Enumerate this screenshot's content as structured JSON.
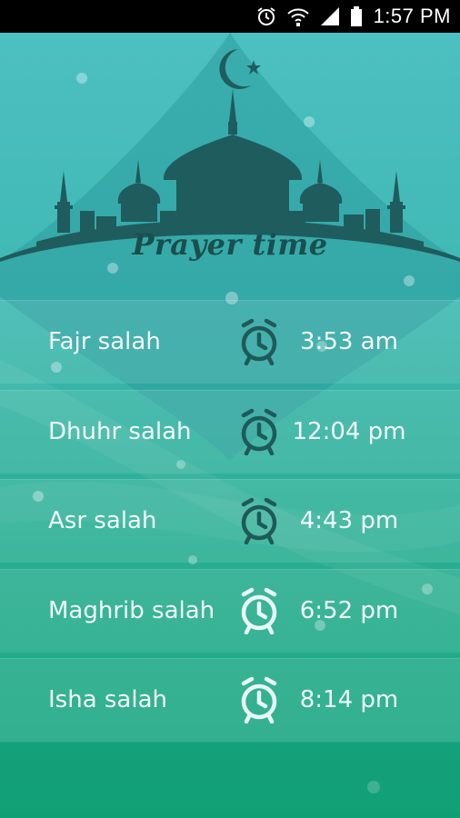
{
  "status_bar": {
    "time": "1:57 PM",
    "icons": [
      "alarm-icon",
      "wifi-icon",
      "signal-icon",
      "battery-icon"
    ]
  },
  "header": {
    "title": "Prayer time",
    "art": "mosque-crescent-star-illustration"
  },
  "prayers": [
    {
      "name": "Fajr salah",
      "time": "3:53 am",
      "alarm": "on"
    },
    {
      "name": "Dhuhr salah",
      "time": "12:04 pm",
      "alarm": "on"
    },
    {
      "name": "Asr salah",
      "time": "4:43 pm",
      "alarm": "on"
    },
    {
      "name": "Maghrib salah",
      "time": "6:52 pm",
      "alarm": "off"
    },
    {
      "name": "Isha salah",
      "time": "8:14 pm",
      "alarm": "off"
    }
  ],
  "colors": {
    "alarm_on": "#1e5a5a",
    "alarm_off": "#eafaf7",
    "text": "#f1fbf9",
    "title": "#1b4e4e"
  }
}
